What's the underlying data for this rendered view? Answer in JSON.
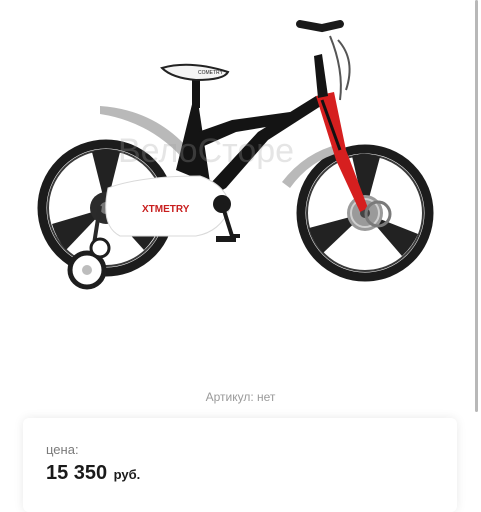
{
  "product": {
    "image_alt": "bicycle-photo",
    "brand_text": "COMETRY",
    "frame_text": "XTMETRY",
    "watermark": "ВелоСторе",
    "sku_text": "Артикул: нет"
  },
  "price": {
    "label": "цена:",
    "value": "15 350",
    "currency": "руб."
  },
  "colors": {
    "frame": "#141414",
    "fork": "#d61f1f",
    "chainguard": "#ffffff",
    "wheels": "#1c1c1c",
    "fenders": "#b9b9b9"
  }
}
